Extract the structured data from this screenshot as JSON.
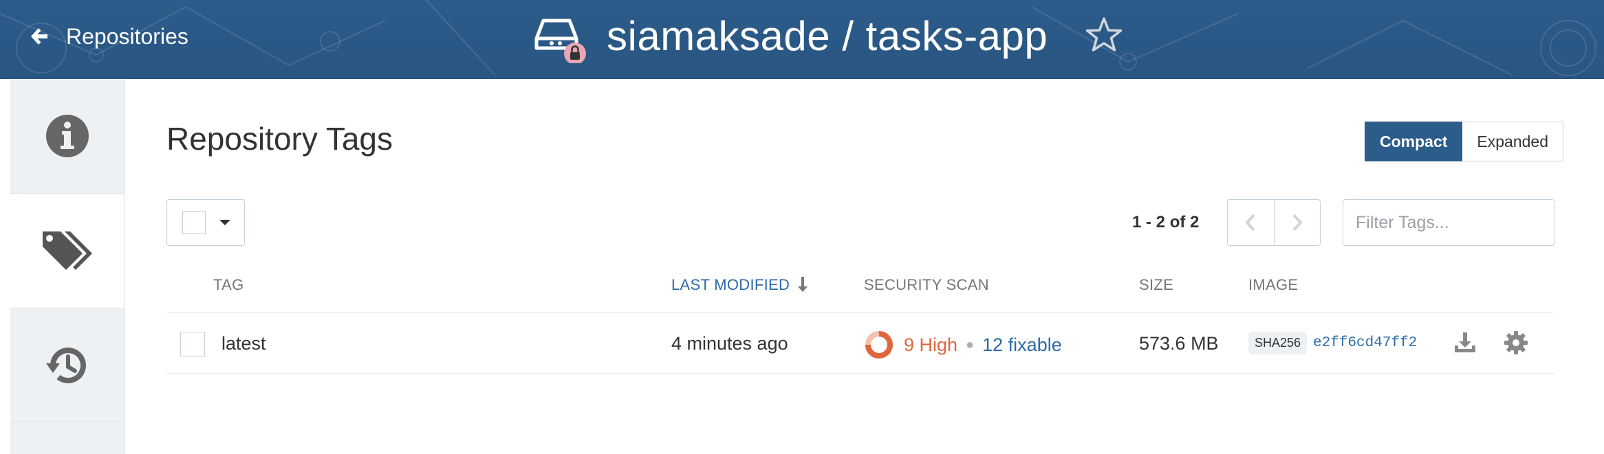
{
  "header": {
    "back_label": "Repositories",
    "repo_name": "siamaksade / tasks-app"
  },
  "sidebar": {
    "items": [
      {
        "name": "info-icon"
      },
      {
        "name": "tags-icon",
        "active": true
      },
      {
        "name": "history-icon"
      }
    ]
  },
  "main": {
    "title": "Repository Tags",
    "view_toggle": {
      "compact": "Compact",
      "expanded": "Expanded",
      "selected": "Compact"
    },
    "pagination": {
      "range_text": "1 - 2 of 2"
    },
    "filter": {
      "placeholder": "Filter Tags..."
    },
    "table": {
      "columns": {
        "tag": "TAG",
        "last_modified": "LAST MODIFIED",
        "security_scan": "SECURITY SCAN",
        "size": "SIZE",
        "image": "IMAGE"
      },
      "rows": [
        {
          "tag": "latest",
          "last_modified": "4 minutes ago",
          "scan_high": "9 High",
          "scan_fixable": "12 fixable",
          "size": "573.6 MB",
          "image_algo": "SHA256",
          "image_hash": "e2ff6cd47ff2"
        }
      ]
    }
  },
  "colors": {
    "header_bg": "#2c5c8a",
    "accent": "#2c6aa8",
    "high_severity": "#e0663d"
  }
}
